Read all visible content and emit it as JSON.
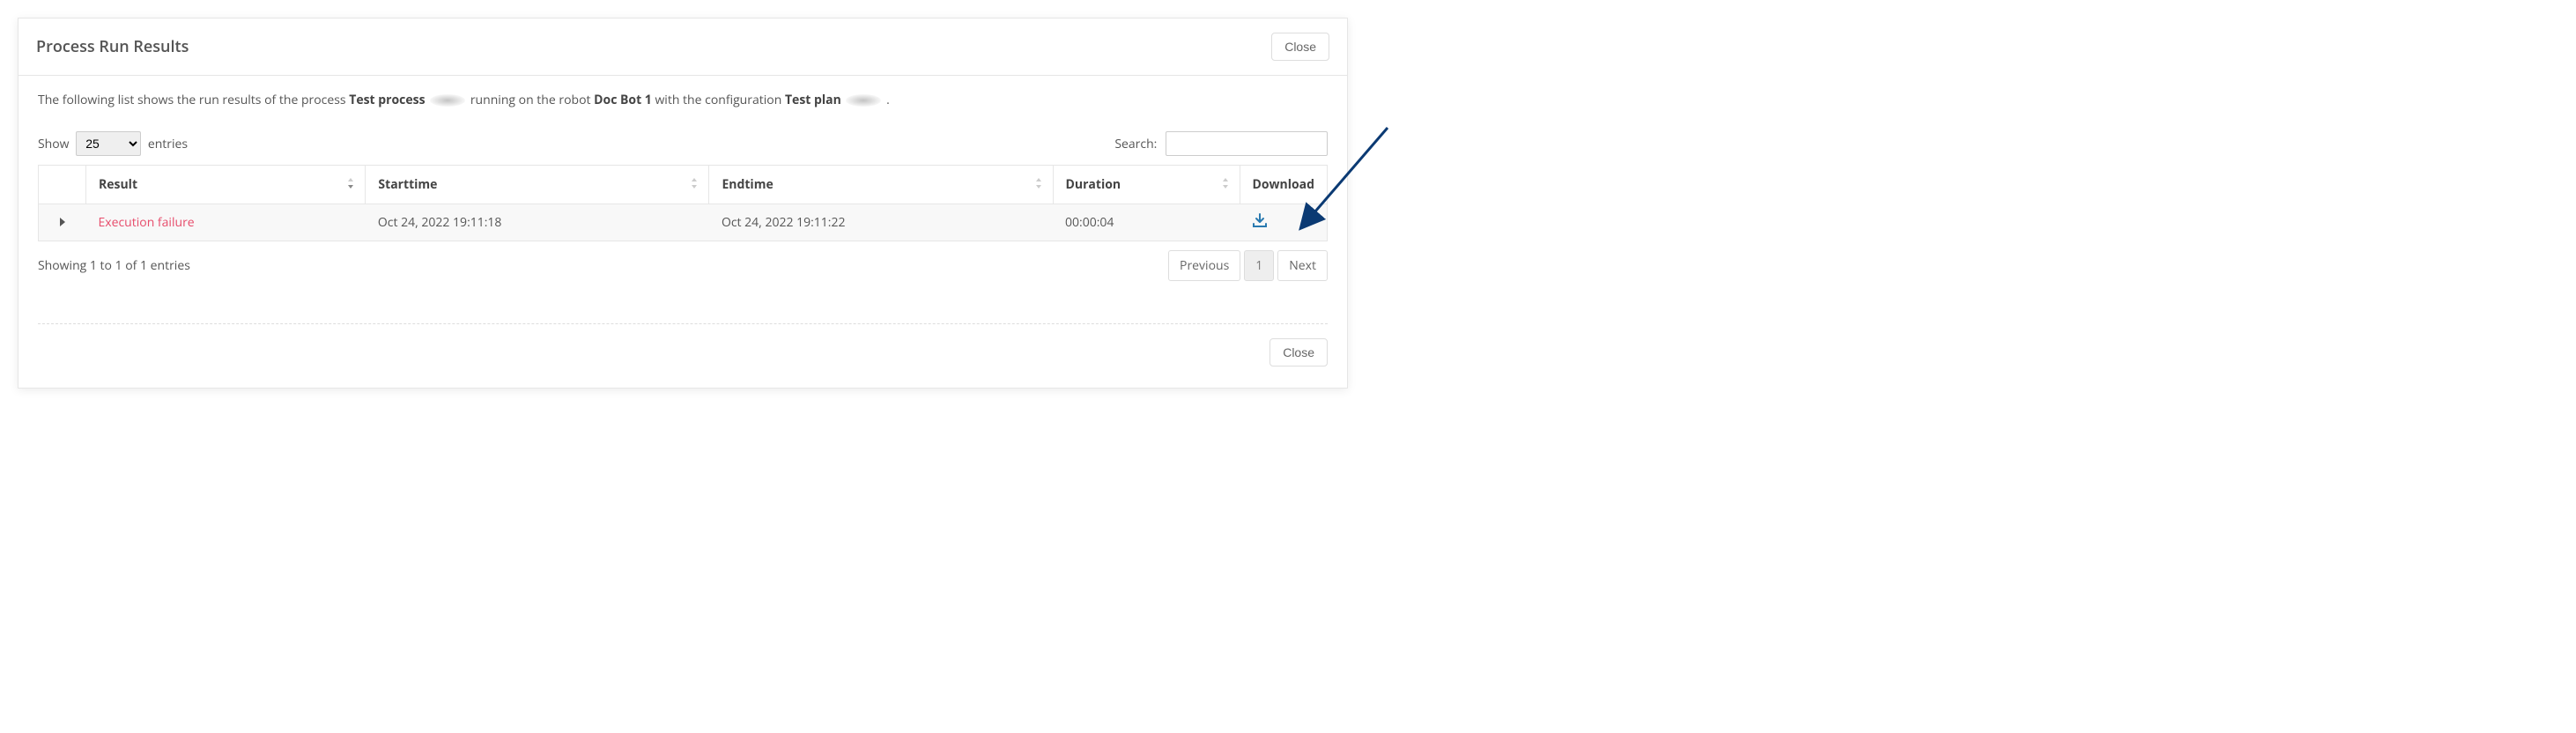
{
  "header": {
    "title": "Process Run Results",
    "close": "Close"
  },
  "intro": {
    "pre": "The following list shows the run results of the process ",
    "process": "Test process ",
    "mid1": " running on the robot ",
    "robot": "Doc Bot 1 ",
    "mid2": "with the configuration ",
    "plan": "Test plan ",
    "post": "."
  },
  "controls": {
    "show": "Show",
    "entries": "entries",
    "page_size": "25",
    "search_label": "Search:"
  },
  "cols": {
    "result": "Result",
    "start": "Starttime",
    "end": "Endtime",
    "duration": "Duration",
    "download": "Download"
  },
  "rows": [
    {
      "result": "Execution failure",
      "start": "Oct 24, 2022 19:11:18",
      "end": "Oct 24, 2022 19:11:22",
      "duration": "00:00:04"
    }
  ],
  "pager": {
    "info": "Showing 1 to 1 of 1 entries",
    "prev": "Previous",
    "page": "1",
    "next": "Next"
  },
  "footer": {
    "close": "Close"
  }
}
